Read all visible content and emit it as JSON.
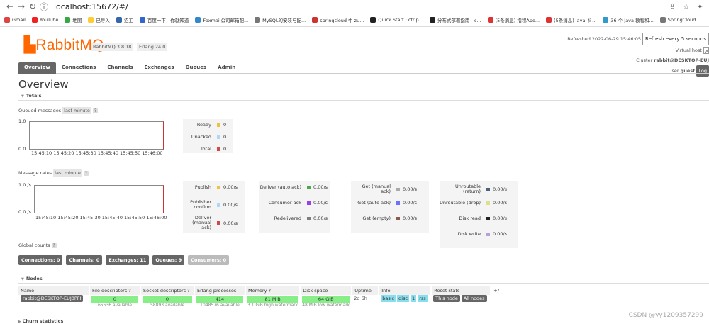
{
  "browser": {
    "url": "localhost:15672/#/",
    "bookmarks": [
      {
        "label": "Gmail",
        "color": "#d44"
      },
      {
        "label": "YouTube",
        "color": "#e22"
      },
      {
        "label": "地图",
        "color": "#3a4"
      },
      {
        "label": "已导入",
        "color": "#fc3"
      },
      {
        "label": "招工",
        "color": "#36a"
      },
      {
        "label": "百度一下，你就知道",
        "color": "#36c"
      },
      {
        "label": "Foxmail公司邮箱配...",
        "color": "#38c"
      },
      {
        "label": "MySQL的安装与配...",
        "color": "#777"
      },
      {
        "label": "springcloud 中 zu...",
        "color": "#c33"
      },
      {
        "label": "Quick Start · ctrip...",
        "color": "#222"
      },
      {
        "label": "分布式部署指南 - c...",
        "color": "#222"
      },
      {
        "label": "(5条消息) 撸程Apo...",
        "color": "#d33"
      },
      {
        "label": "(5条消息) java_抖...",
        "color": "#d33"
      },
      {
        "label": "36 个 Java 教程和...",
        "color": "#39c"
      },
      {
        "label": "SpringCloud",
        "color": "#777"
      }
    ]
  },
  "header": {
    "logo": "RabbitMQ",
    "logo_tm": "TM",
    "version": "RabbitMQ 3.8.18",
    "erlang": "Erlang 24.0",
    "refreshed": "Refreshed 2022-06-29 15:46:05",
    "refresh_select": "Refresh every 5 seconds",
    "virtual_host_label": "Virtual host",
    "virtual_host_value": "A",
    "cluster_label": "Cluster",
    "cluster_value": "rabbit@DESKTOP-EUJ",
    "user_label": "User",
    "user_value": "guest",
    "logout": "Log"
  },
  "tabs": [
    "Overview",
    "Connections",
    "Channels",
    "Exchanges",
    "Queues",
    "Admin"
  ],
  "page_title": "Overview",
  "totals": {
    "section": "Totals",
    "queued_label": "Queued messages",
    "queued_range": "last minute",
    "help": "?",
    "y_top": "1.0",
    "y_bottom": "0.0",
    "x_ticks": "15:45:10 15:45:20 15:45:30 15:45:40 15:45:50 15:46:00",
    "legend": [
      {
        "label": "Ready",
        "value": "0",
        "color": "#edc240"
      },
      {
        "label": "Unacked",
        "value": "0",
        "color": "#afd8f8"
      },
      {
        "label": "Total",
        "value": "0",
        "color": "#cb4b4b"
      }
    ]
  },
  "rates": {
    "label": "Message rates",
    "range": "last minute",
    "help": "?",
    "y_top": "1.0 /s",
    "y_bottom": "0.0 /s",
    "x_ticks": "15:45:10 15:45:20 15:45:30 15:45:40 15:45:50 15:46:00",
    "col1": [
      {
        "label": "Publish",
        "value": "0.00/s",
        "color": "#edc240"
      },
      {
        "label": "Publisher confirm",
        "value": "0.00/s",
        "color": "#afd8f8"
      },
      {
        "label": "Deliver (manual ack)",
        "value": "0.00/s",
        "color": "#cb4b4b"
      }
    ],
    "col2": [
      {
        "label": "Deliver (auto ack)",
        "value": "0.00/s",
        "color": "#4da74d"
      },
      {
        "label": "Consumer ack",
        "value": "0.00/s",
        "color": "#9440ed"
      },
      {
        "label": "Redelivered",
        "value": "0.00/s",
        "color": "#7e7e7e"
      }
    ],
    "col3": [
      {
        "label": "Get (manual ack)",
        "value": "0.00/s",
        "color": "#aaaaaa"
      },
      {
        "label": "Get (auto ack)",
        "value": "0.00/s",
        "color": "#7070ff"
      },
      {
        "label": "Get (empty)",
        "value": "0.00/s",
        "color": "#8b5a4b"
      }
    ],
    "col4": [
      {
        "label": "Unroutable (return)",
        "value": "0.00/s",
        "color": "#4d6278"
      },
      {
        "label": "Unroutable (drop)",
        "value": "0.00/s",
        "color": "#e0e08a"
      },
      {
        "label": "Disk read",
        "value": "0.00/s",
        "color": "#222222"
      },
      {
        "label": "Disk write",
        "value": "0.00/s",
        "color": "#b8a0d8"
      }
    ]
  },
  "global_counts": {
    "label": "Global counts",
    "help": "?",
    "buttons": [
      {
        "label": "Connections: 0",
        "enabled": true
      },
      {
        "label": "Channels: 0",
        "enabled": true
      },
      {
        "label": "Exchanges: 11",
        "enabled": true
      },
      {
        "label": "Queues: 9",
        "enabled": true
      },
      {
        "label": "Consumers: 0",
        "enabled": false
      }
    ]
  },
  "nodes": {
    "section": "Nodes",
    "columns": [
      "Name",
      "File descriptors ?",
      "Socket descriptors ?",
      "Erlang processes",
      "Memory ?",
      "Disk space",
      "Uptime",
      "Info",
      "Reset stats"
    ],
    "plusminus": "+/-",
    "row": {
      "name": "rabbit@DESKTOP-EUJ0PFI",
      "fd": "0",
      "fd_sub": "65536 available",
      "sd": "0",
      "sd_sub": "58893 available",
      "erl": "414",
      "erl_sub": "1048576 available",
      "mem": "81 MiB",
      "mem_sub": "3.1 GiB high watermark",
      "disk": "64 GiB",
      "disk_sub": "48 MiB low watermark",
      "uptime": "2d 6h",
      "info": [
        "basic",
        "disc",
        "1",
        "rss"
      ],
      "reset": [
        "This node",
        "All nodes"
      ]
    }
  },
  "churn": "Churn statistics",
  "watermark": "CSDN @yy1209357299"
}
